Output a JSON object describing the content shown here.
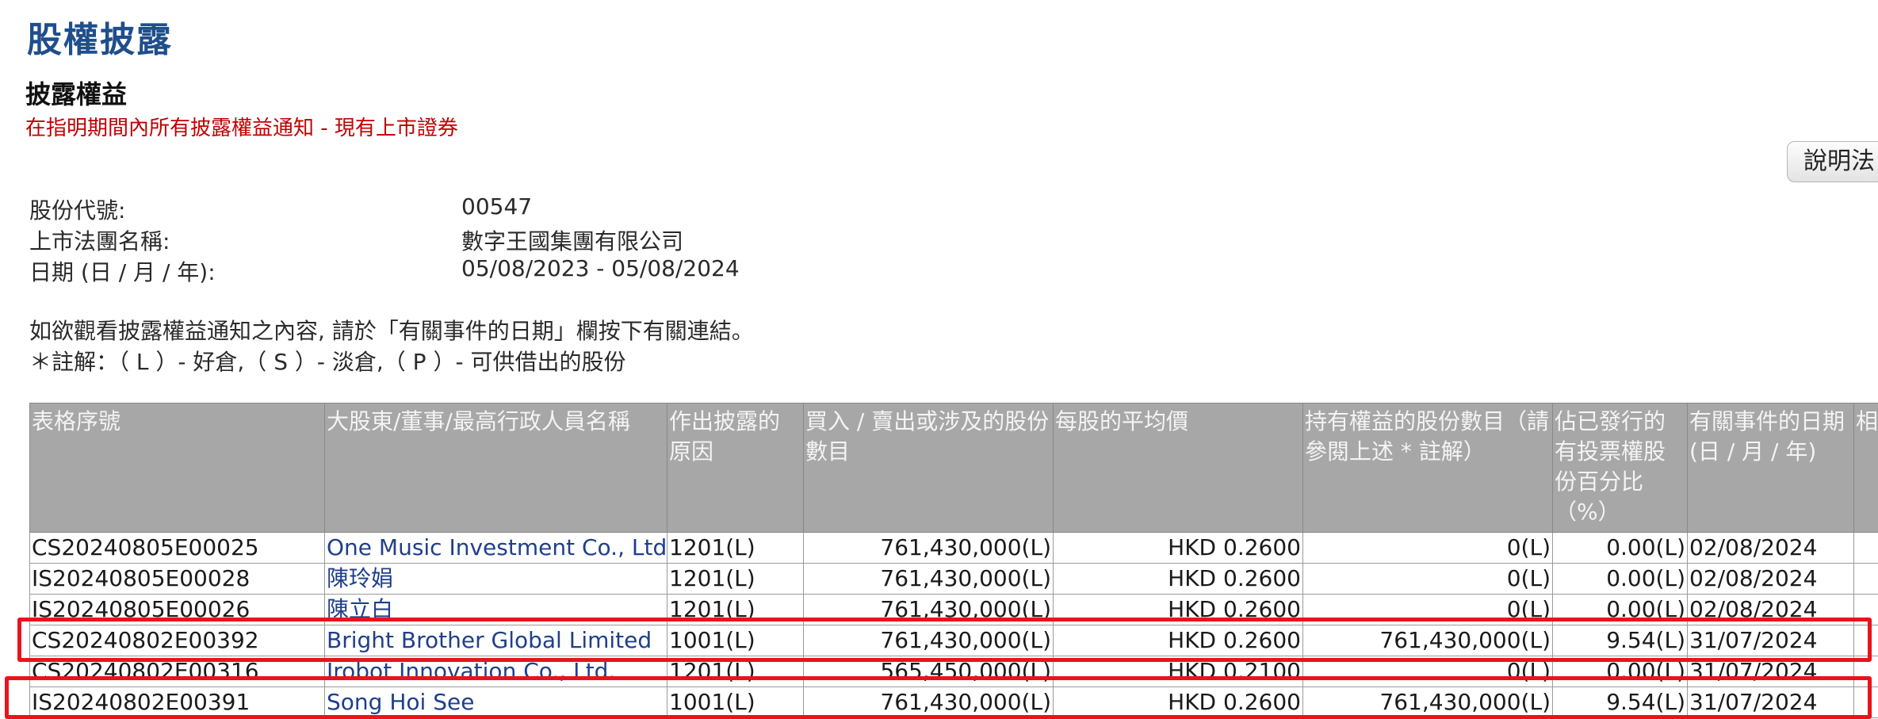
{
  "header": {
    "title": "股權披露",
    "section_title": "披露權益",
    "section_subtitle": "在指明期間內所有披露權益通知 - 現有上市證券",
    "help_button_label": "說明法"
  },
  "info": [
    {
      "label": "股份代號:",
      "value": "00547"
    },
    {
      "label": "上市法團名稱:",
      "value": "數字王國集團有限公司"
    },
    {
      "label": "日期 (日 / 月 / 年):",
      "value": "05/08/2023 - 05/08/2024"
    }
  ],
  "instructions": {
    "line1": "如欲觀看披露權益通知之內容, 請於「有關事件的日期」欄按下有關連結。",
    "line2": "＊註解：（ L ）- 好倉,（ S ）- 淡倉,（ P ）- 可供借出的股份"
  },
  "table": {
    "headers": [
      "表格序號",
      "大股東/董事/最高行政人員名稱",
      "作出披露的原因",
      "買入 / 賣出或涉及的股份數目",
      "每股的平均價",
      "持有權益的股份數目（請參閱上述 * 註解）",
      "佔已發行的有投票權股份百分比（%）",
      "有關事件的日期(日 / 月 / 年)",
      "相"
    ],
    "rows": [
      {
        "form": "CS20240805E00025",
        "name": "One Music Investment Co., Ltd.",
        "reason": "1201(L)",
        "shares": "761,430,000(L)",
        "price": "HKD 0.2600",
        "held": "0(L)",
        "pct": "0.00(L)",
        "date": "02/08/2024"
      },
      {
        "form": "IS20240805E00028",
        "name": "陳玲娟",
        "reason": "1201(L)",
        "shares": "761,430,000(L)",
        "price": "HKD 0.2600",
        "held": "0(L)",
        "pct": "0.00(L)",
        "date": "02/08/2024"
      },
      {
        "form": "IS20240805E00026",
        "name": "陳立白",
        "reason": "1201(L)",
        "shares": "761,430,000(L)",
        "price": "HKD 0.2600",
        "held": "0(L)",
        "pct": "0.00(L)",
        "date": "02/08/2024"
      },
      {
        "form": "CS20240802E00392",
        "name": "Bright Brother Global Limited",
        "reason": "1001(L)",
        "shares": "761,430,000(L)",
        "price": "HKD 0.2600",
        "held": "761,430,000(L)",
        "pct": "9.54(L)",
        "date": "31/07/2024"
      },
      {
        "form": "CS20240802E00316",
        "name": "Irobot Innovation Co., Ltd.",
        "reason": "1201(L)",
        "shares": "565,450,000(L)",
        "price": "HKD 0.2100",
        "held": "0(L)",
        "pct": "0.00(L)",
        "date": "31/07/2024"
      },
      {
        "form": "IS20240802E00391",
        "name": "Song Hoi See",
        "reason": "1001(L)",
        "shares": "761,430,000(L)",
        "price": "HKD 0.2600",
        "held": "761,430,000(L)",
        "pct": "9.54(L)",
        "date": "31/07/2024"
      }
    ]
  },
  "highlight_color": "#e8141c"
}
